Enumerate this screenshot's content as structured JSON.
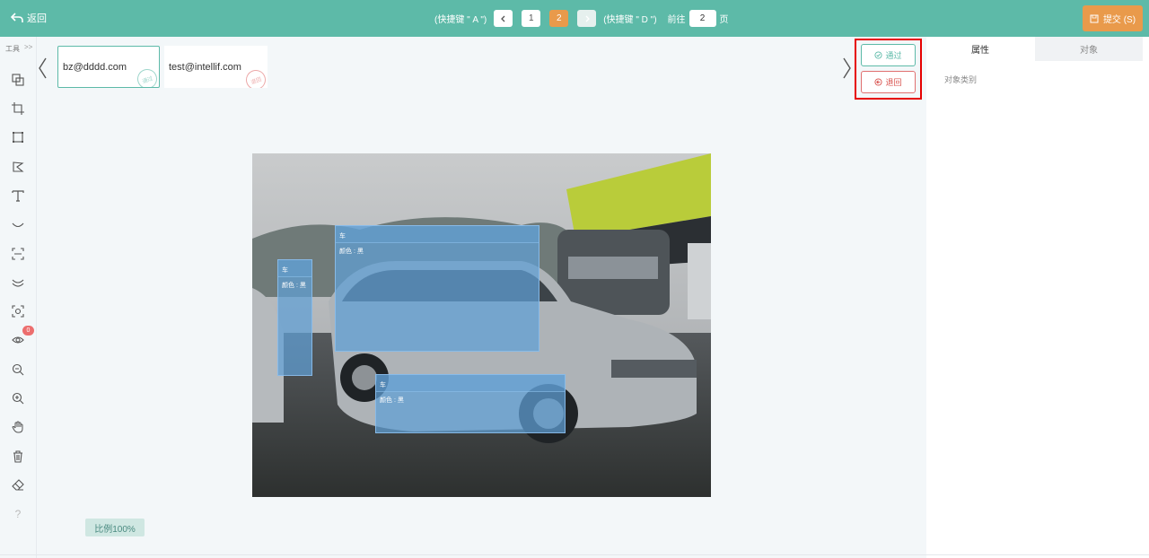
{
  "header": {
    "back_label": "返回",
    "prev_hint": "(快捷键 \" A \")",
    "pages": [
      "1",
      "2"
    ],
    "current_page": "2",
    "next_hint": "(快捷键 \" D \")",
    "goto_label": "前往",
    "goto_value": "2",
    "goto_suffix": "页",
    "submit_label": "提交 (S)"
  },
  "toolbar": {
    "title": "工具",
    "expand": ">>",
    "tools": [
      "copy-icon",
      "crop-icon",
      "rectangle-icon",
      "polygon-icon",
      "text-tool-icon",
      "curve-icon",
      "dashed-select-icon",
      "multi-curve-icon",
      "focus-icon",
      "eye-icon",
      "zoom-out-icon",
      "zoom-in-icon",
      "hand-icon",
      "trash-icon",
      "eraser-icon",
      "help-icon"
    ],
    "visibility_badge": "0"
  },
  "cards": [
    {
      "email": "bz@dddd.com",
      "stamp": "通过"
    },
    {
      "email": "test@intellif.com",
      "stamp": "退回"
    }
  ],
  "review": {
    "pass_label": "通过",
    "reject_label": "退回"
  },
  "annotations": [
    {
      "class": "车",
      "attr": "颜色 : 黑"
    },
    {
      "class": "车",
      "attr": "颜色 : 黑"
    },
    {
      "class": "车",
      "attr": "颜色 : 黑"
    }
  ],
  "zoom_label": "比例100%",
  "panel": {
    "tab_attributes": "属性",
    "tab_objects": "对象",
    "object_category_label": "对象类别"
  },
  "colors": {
    "primary": "#5dbaa8",
    "accent": "#e99a4b",
    "reject": "#d9534f",
    "highlight": "#e60000"
  }
}
